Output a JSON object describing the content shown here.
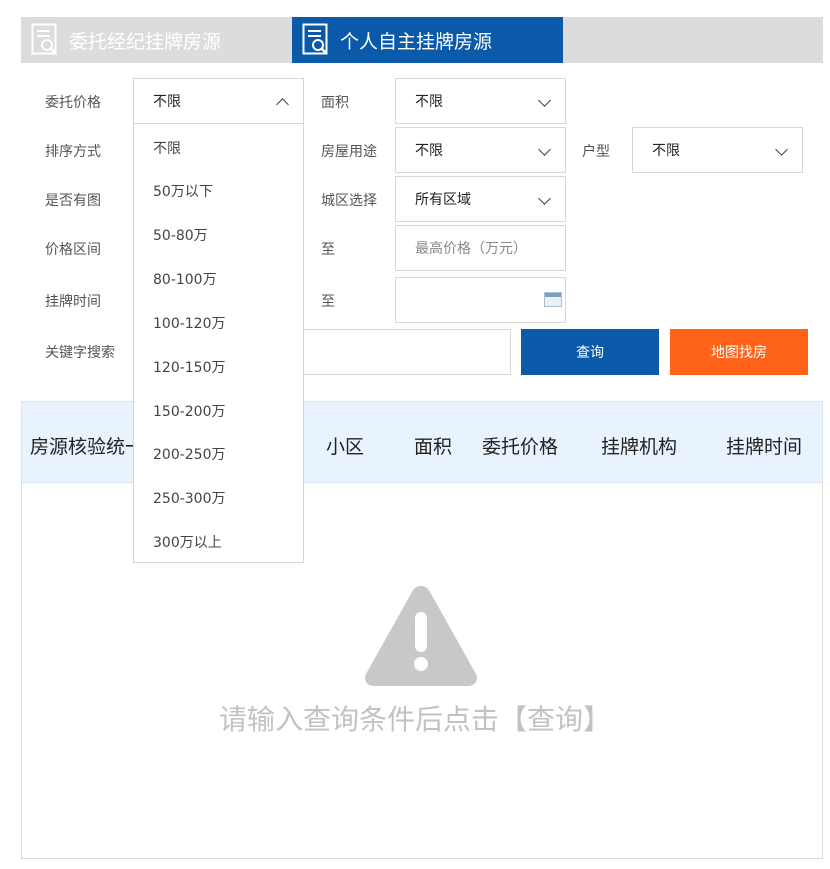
{
  "tabs": {
    "agent": "委托经纪挂牌房源",
    "personal": "个人自主挂牌房源"
  },
  "form": {
    "price_label": "委托价格",
    "price_value": "不限",
    "area_label": "面积",
    "area_value": "不限",
    "sort_label": "排序方式",
    "usage_label": "房屋用途",
    "usage_value": "不限",
    "layout_label": "户型",
    "layout_value": "不限",
    "image_label": "是否有图",
    "district_label": "城区选择",
    "district_value": "所有区域",
    "price_range_label": "价格区间",
    "to1": "至",
    "max_price_placeholder": "最高价格（万元）",
    "listing_time_label": "挂牌时间",
    "to2": "至",
    "keyword_label": "关键字搜索"
  },
  "buttons": {
    "query": "查询",
    "map": "地图找房"
  },
  "price_options": [
    "不限",
    "50万以下",
    "50-80万",
    "80-100万",
    "100-120万",
    "120-150万",
    "150-200万",
    "200-250万",
    "250-300万",
    "300万以上"
  ],
  "table": {
    "col_code": "房源核验统一",
    "col_community": "小区",
    "col_area": "面积",
    "col_price": "委托价格",
    "col_agency": "挂牌机构",
    "col_time": "挂牌时间"
  },
  "empty_message": "请输入查询条件后点击【查询】",
  "colors": {
    "primary": "#0b5aa9",
    "accent": "#ff6319",
    "header_bg": "#e8f3fd",
    "tab_bg": "#dcdcdc"
  }
}
